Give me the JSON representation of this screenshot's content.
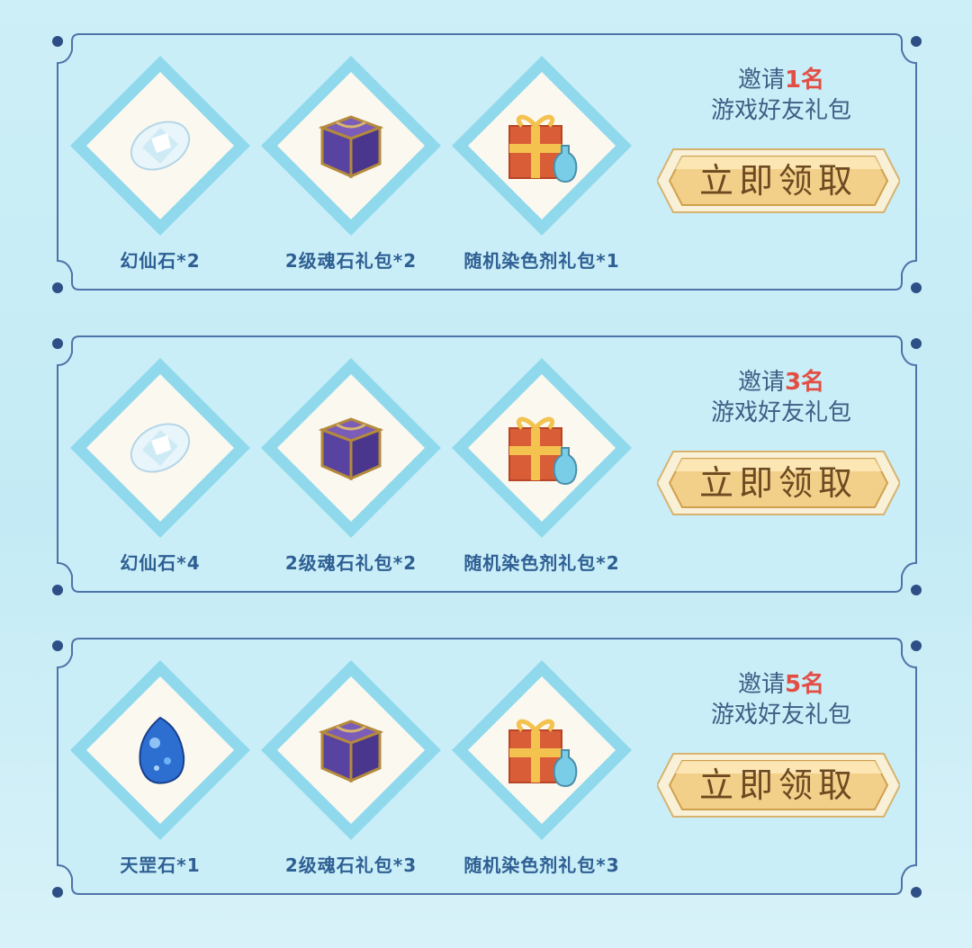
{
  "colors": {
    "frame": "#4e73a8",
    "frame_fill": "#c9eef8",
    "item_text": "#2f5f93",
    "invite_text": "#3f5f84",
    "invite_count": "#e34e44",
    "button_gold": "#f3d08a",
    "button_text": "#6d4a21"
  },
  "tiers": [
    {
      "invite_prefix": "邀请",
      "invite_count": "1名",
      "invite_suffix": "游戏好友礼包",
      "button_label": "立即领取",
      "items": [
        {
          "name": "幻仙石*2",
          "icon": "crystal-icon"
        },
        {
          "name": "2级魂石礼包*2",
          "icon": "treasure-chest-icon"
        },
        {
          "name": "随机染色剂礼包*1",
          "icon": "gift-box-potion-icon"
        }
      ]
    },
    {
      "invite_prefix": "邀请",
      "invite_count": "3名",
      "invite_suffix": "游戏好友礼包",
      "button_label": "立即领取",
      "items": [
        {
          "name": "幻仙石*4",
          "icon": "crystal-icon"
        },
        {
          "name": "2级魂石礼包*2",
          "icon": "treasure-chest-icon"
        },
        {
          "name": "随机染色剂礼包*2",
          "icon": "gift-box-potion-icon"
        }
      ]
    },
    {
      "invite_prefix": "邀请",
      "invite_count": "5名",
      "invite_suffix": "游戏好友礼包",
      "button_label": "立即领取",
      "items": [
        {
          "name": "天罡石*1",
          "icon": "blue-gem-icon"
        },
        {
          "name": "2级魂石礼包*3",
          "icon": "treasure-chest-icon"
        },
        {
          "name": "随机染色剂礼包*3",
          "icon": "gift-box-potion-icon"
        }
      ]
    }
  ]
}
